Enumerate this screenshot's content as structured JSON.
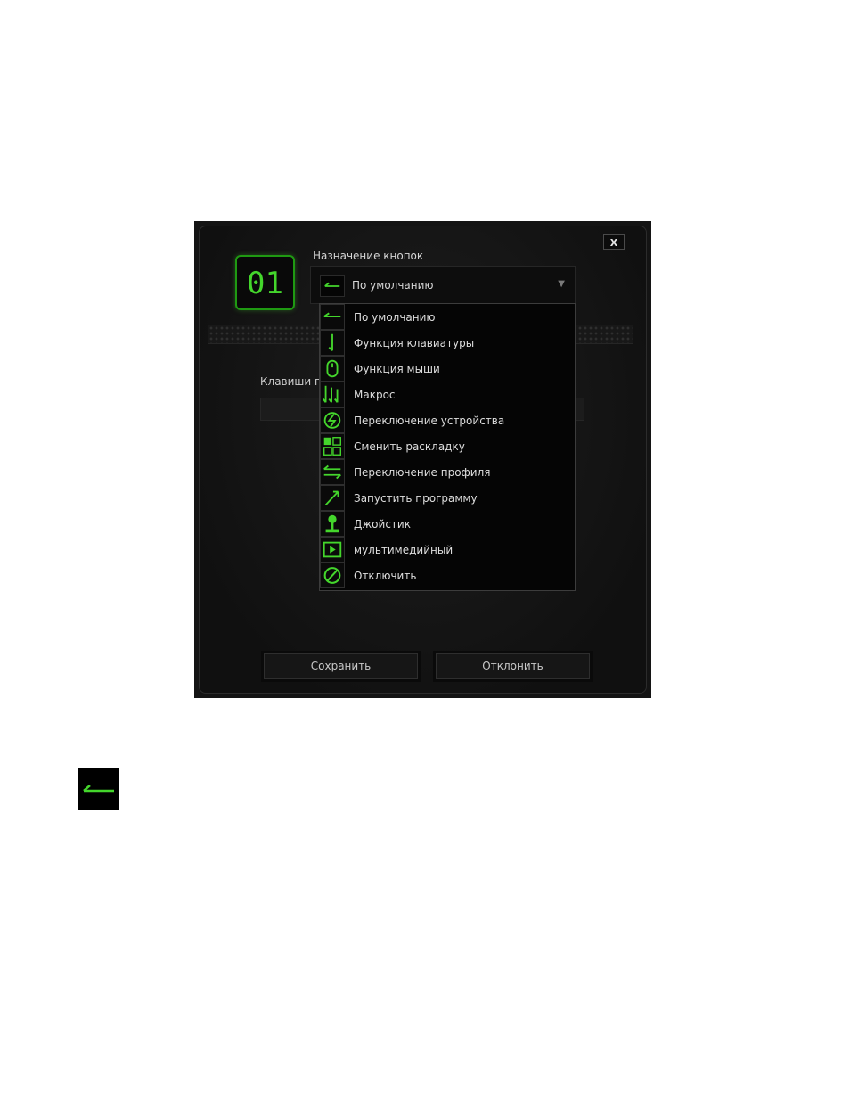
{
  "dialog": {
    "close_label": "X",
    "badge_number": "01",
    "assignment_title": "Назначение кнопок",
    "selected_value": "По умолчанию",
    "keys_label": "Клавиши п",
    "save_label": "Сохранить",
    "cancel_label": "Отклонить"
  },
  "dropdown_options": [
    {
      "label": "По умолчанию",
      "icon": "default-arrow-icon"
    },
    {
      "label": "Функция клавиатуры",
      "icon": "keyboard-function-icon"
    },
    {
      "label": "Функция мыши",
      "icon": "mouse-icon"
    },
    {
      "label": "Макрос",
      "icon": "macro-icon"
    },
    {
      "label": "Переключение устройства",
      "icon": "device-switch-icon"
    },
    {
      "label": "Сменить раскладку",
      "icon": "keymap-switch-icon"
    },
    {
      "label": "Переключение профиля",
      "icon": "profile-switch-icon"
    },
    {
      "label": "Запустить программу",
      "icon": "launch-program-icon"
    },
    {
      "label": "Джойстик",
      "icon": "joystick-icon"
    },
    {
      "label": "мультимедийный",
      "icon": "multimedia-icon"
    },
    {
      "label": "Отключить",
      "icon": "disable-icon"
    }
  ],
  "colors": {
    "accent": "#44d62c",
    "panel": "#141414",
    "text": "#d6d6d6"
  }
}
